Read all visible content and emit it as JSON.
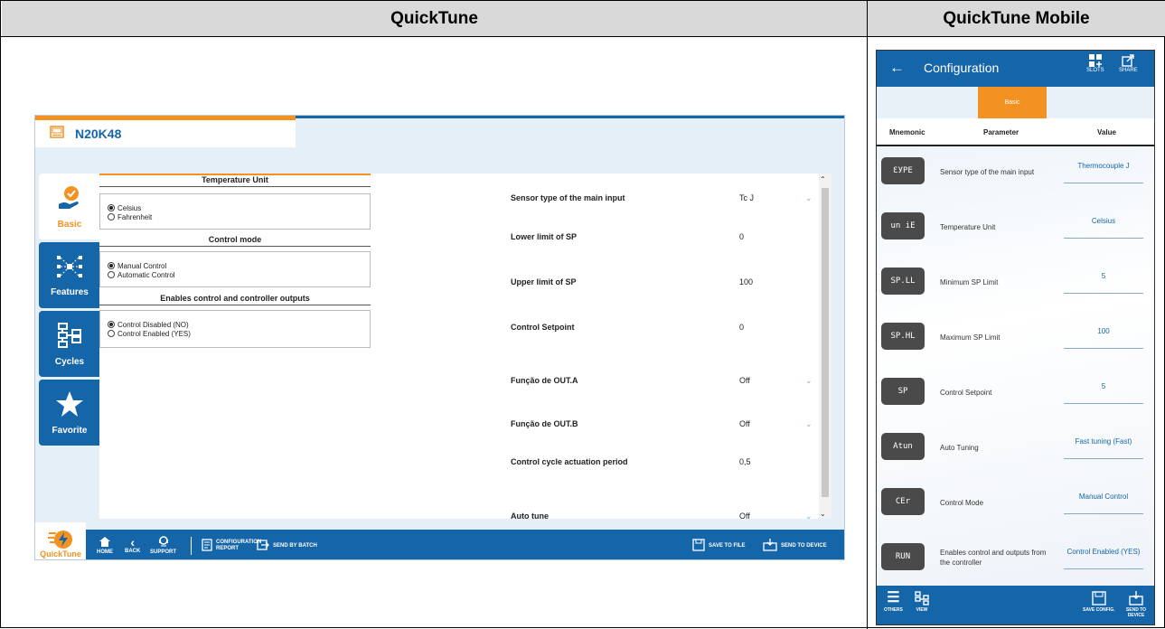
{
  "columns": {
    "left_header": "QuickTune",
    "right_header": "QuickTune Mobile"
  },
  "desktop": {
    "device_name": "N20K48",
    "sidebar": [
      {
        "label": "Basic",
        "icon": "hand-check-icon",
        "active": true
      },
      {
        "label": "Features",
        "icon": "network-icon",
        "active": false
      },
      {
        "label": "Cycles",
        "icon": "flowchart-icon",
        "active": false
      },
      {
        "label": "Favorite",
        "icon": "star-icon",
        "active": false
      }
    ],
    "sections": [
      {
        "title": "Temperature Unit",
        "options": [
          {
            "label": "Celsius",
            "selected": true
          },
          {
            "label": "Fahrenheit",
            "selected": false
          }
        ]
      },
      {
        "title": "Control mode",
        "options": [
          {
            "label": "Manual Control",
            "selected": true
          },
          {
            "label": "Automatic Control",
            "selected": false
          }
        ]
      },
      {
        "title": "Enables control and controller outputs",
        "options": [
          {
            "label": "Control Disabled (NO)",
            "selected": true
          },
          {
            "label": "Control Enabled (YES)",
            "selected": false
          }
        ]
      }
    ],
    "params": [
      {
        "label": "Sensor type of the main input",
        "value": "Tc J",
        "dropdown": true
      },
      {
        "label": "Lower limit of SP",
        "value": "0",
        "dropdown": false
      },
      {
        "label": "Upper limit of SP",
        "value": "100",
        "dropdown": false
      },
      {
        "label": "Control Setpoint",
        "value": "0",
        "dropdown": false
      },
      {
        "label": "Função de OUT.A",
        "value": "Off",
        "dropdown": true
      },
      {
        "label": "Função de OUT.B",
        "value": "Off",
        "dropdown": true
      },
      {
        "label": "Control cycle actuation period",
        "value": "0,5",
        "dropdown": false
      },
      {
        "label": "Auto tune",
        "value": "Off",
        "dropdown": true
      }
    ],
    "bottombar": {
      "logo_text": "QuickTune",
      "home": "HOME",
      "back": "BACK",
      "support": "SUPPORT",
      "configuration_report": "CONFIGURATION REPORT",
      "send_by_batch": "SEND BY BATCH",
      "save_to_file": "SAVE TO FILE",
      "send_to_device": "SEND TO DEVICE"
    }
  },
  "mobile": {
    "title": "Configuration",
    "slots": "SLOTS",
    "share": "SHARE",
    "tab": "Basic",
    "col_mnemonic": "Mnemonic",
    "col_parameter": "Parameter",
    "col_value": "Value",
    "rows": [
      {
        "mnemonic": "ƐУPE",
        "parameter": "Sensor type of the main input",
        "value": "Thermocouple J"
      },
      {
        "mnemonic": "un iE",
        "parameter": "Temperature Unit",
        "value": "Celsius"
      },
      {
        "mnemonic": "SP.LL",
        "parameter": "Minimum SP Limit",
        "value": "5"
      },
      {
        "mnemonic": "SP.HL",
        "parameter": "Maximum SP Limit",
        "value": "100"
      },
      {
        "mnemonic": "SP",
        "parameter": "Control Setpoint",
        "value": "5"
      },
      {
        "mnemonic": "Atun",
        "parameter": "Auto Tuning",
        "value": "Fast tuning (Fast)"
      },
      {
        "mnemonic": "CEr",
        "parameter": "Control Mode",
        "value": "Manual Control"
      },
      {
        "mnemonic": "RUN",
        "parameter": "Enables control and outputs from the controller",
        "value": "Control Enabled (YES)"
      }
    ],
    "bottom": {
      "others": "OTHERS",
      "view": "VIEW",
      "save_config": "SAVE CONFIG.",
      "send_to_device": "SEND TO DEVICE"
    }
  },
  "colors": {
    "brand_blue": "#1565a9",
    "accent_orange": "#f39121"
  }
}
